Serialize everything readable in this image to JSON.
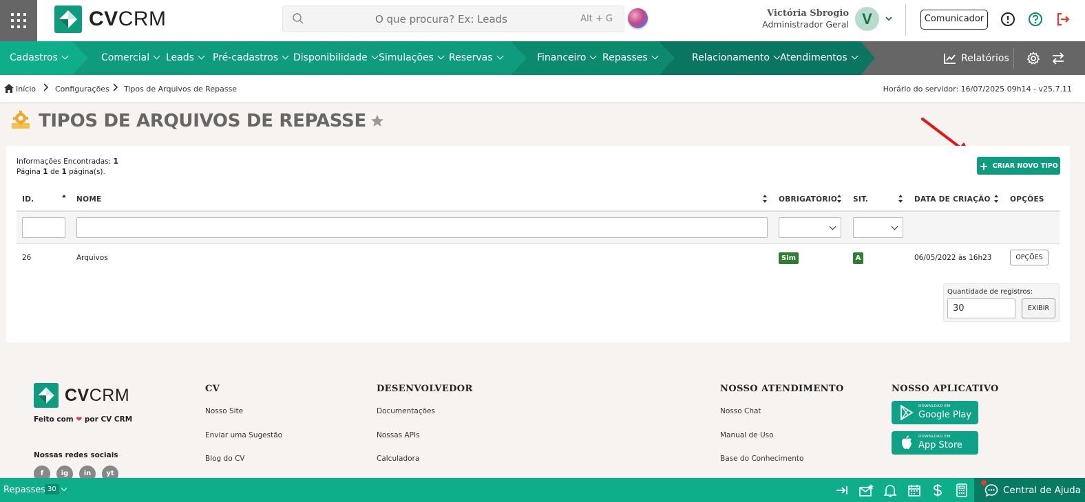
{
  "header": {
    "logo_text_bold": "CV",
    "logo_text": "CRM",
    "search_placeholder": "O que procura? Ex: Leads",
    "search_shortcut": "Alt + G",
    "user_name": "Victória Sbrogio",
    "user_role": "Administrador Geral",
    "avatar_letter": "V",
    "comunicador_label": "Comunicador"
  },
  "nav": {
    "items": [
      "Cadastros",
      "Comercial",
      "Leads",
      "Pré-cadastros",
      "Disponibilidade",
      "Simulações",
      "Reservas",
      "Financeiro",
      "Repasses",
      "Relacionamento",
      "Atendimentos"
    ],
    "relatorios": "Relatórios",
    "colors": {
      "teal_light": "#0fae8b",
      "teal_mid": "#0f9b7d",
      "teal_dark": "#0a7a62",
      "grey": "#666666"
    }
  },
  "breadcrumb": {
    "items": [
      "Início",
      "Configurações",
      "Tipos de Arquivos de Repasse"
    ],
    "server_time": "Horário do servidor: 16/07/2025 09h14 - v25.7.11"
  },
  "page": {
    "title": "TIPOS DE ARQUIVOS DE REPASSE",
    "info_label": "Informações Encontradas:",
    "info_count": "1",
    "page_word": "Página",
    "page_current": "1",
    "page_of": "de",
    "page_total": "1",
    "page_suffix": "página(s).",
    "new_button": "CRIAR NOVO TIPO"
  },
  "table": {
    "columns": [
      "ID.",
      "NOME",
      "OBRIGATÓRIO",
      "SIT.",
      "DATA DE CRIAÇÃO",
      "OPÇÕES"
    ],
    "rows": [
      {
        "id": "26",
        "nome": "Arquivos",
        "obrigatorio": "Sim",
        "sit": "A",
        "data": "06/05/2022 às 16h23",
        "opcoes": "OPÇÕES"
      }
    ]
  },
  "pagination": {
    "label": "Quantidade de registros:",
    "value": "30",
    "button": "EXIBIR"
  },
  "footer": {
    "made_with": "Feito com",
    "made_by": "por CV CRM",
    "social_label": "Nossas redes sociais",
    "social": [
      "f",
      "ig",
      "in",
      "yt"
    ],
    "cv_head": "CV",
    "cv_links": [
      "Nosso Site",
      "Enviar uma Sugestão",
      "Blog do CV"
    ],
    "dev_head": "DESENVOLVEDOR",
    "dev_links": [
      "Documentações",
      "Nossas APIs",
      "Calculadora"
    ],
    "support_head": "NOSSO ATENDIMENTO",
    "support_links": [
      "Nosso Chat",
      "Manual de Uso",
      "Base do Conhecimento"
    ],
    "app_head": "NOSSO APLICATIVO",
    "google_small": "DOWNLOAD EM",
    "google_big": "Google Play",
    "apple_small": "DOWNLOAD EM",
    "apple_big": "App Store"
  },
  "bottombar": {
    "module": "Repasses",
    "count": "30",
    "help": "Central de Ajuda"
  }
}
